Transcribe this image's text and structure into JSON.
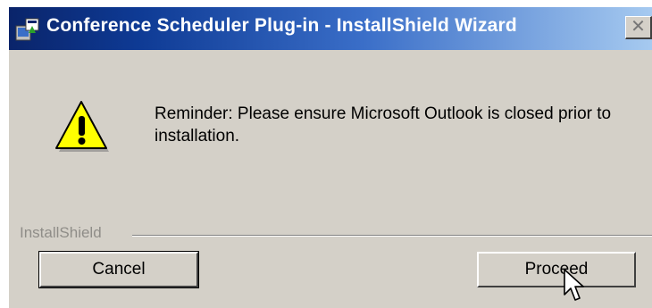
{
  "window": {
    "title": "Conference Scheduler Plug-in - InstallShield Wizard",
    "close_glyph": "✕"
  },
  "message": {
    "text": "Reminder: Please ensure Microsoft Outlook is closed prior to installation.",
    "icon": "warning-icon"
  },
  "footer": {
    "brand": "InstallShield"
  },
  "buttons": {
    "cancel": "Cancel",
    "proceed": "Proceed"
  },
  "colors": {
    "title_bar_start": "#0a246a",
    "title_bar_end": "#a6caf0",
    "dialog_bg": "#d4d0c8",
    "warning_yellow": "#ffff00"
  }
}
